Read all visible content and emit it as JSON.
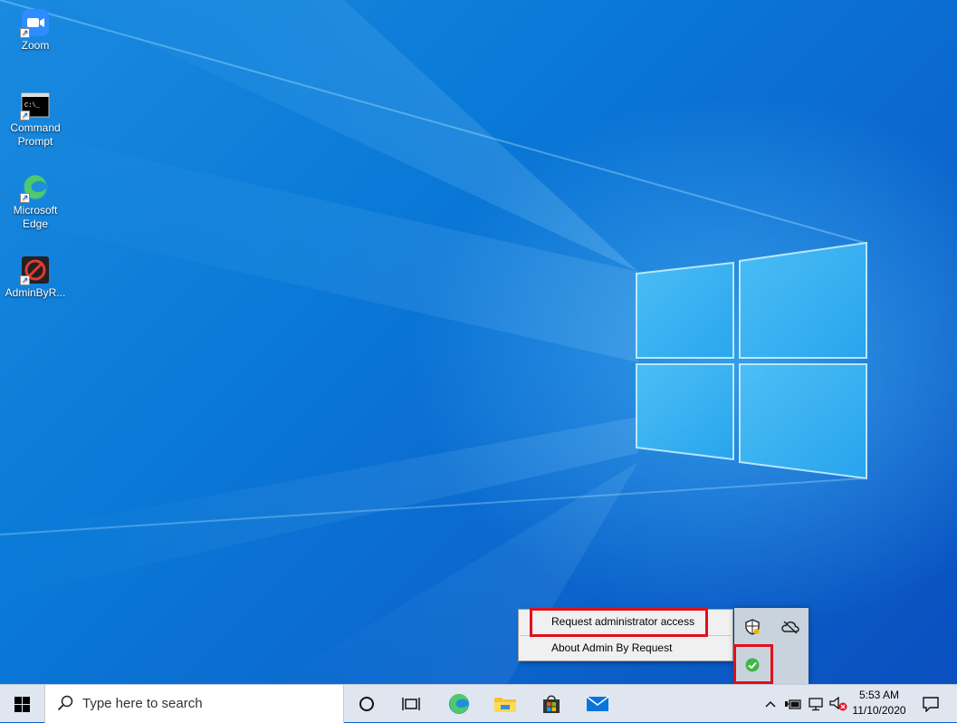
{
  "desktop": {
    "icons": [
      {
        "label": "Zoom",
        "icon": "zoom-icon"
      },
      {
        "label": "Command Prompt",
        "icon": "command-prompt-icon",
        "glyph": "C:\\_"
      },
      {
        "label": "Microsoft Edge",
        "icon": "edge-icon"
      },
      {
        "label": "AdminByR...",
        "icon": "admin-by-request-icon"
      }
    ]
  },
  "context_menu": {
    "items": [
      {
        "label": "Request administrator access"
      },
      {
        "label": "About Admin By Request"
      }
    ]
  },
  "tray_flyout": {
    "icons": [
      "security-shield-icon",
      "cloud-offline-icon",
      "admin-by-request-status-icon"
    ]
  },
  "taskbar": {
    "search_placeholder": "Type here to search",
    "pinned": [
      "cortana-icon",
      "task-view-icon",
      "edge-icon",
      "file-explorer-icon",
      "store-icon",
      "mail-icon"
    ],
    "clock_time": "5:53 AM",
    "clock_date": "11/10/2020"
  },
  "colors": {
    "highlight_box": "#e0101c",
    "taskbar_bg": "#dfe6ef",
    "desktop_blue": "#0a7ad8"
  }
}
